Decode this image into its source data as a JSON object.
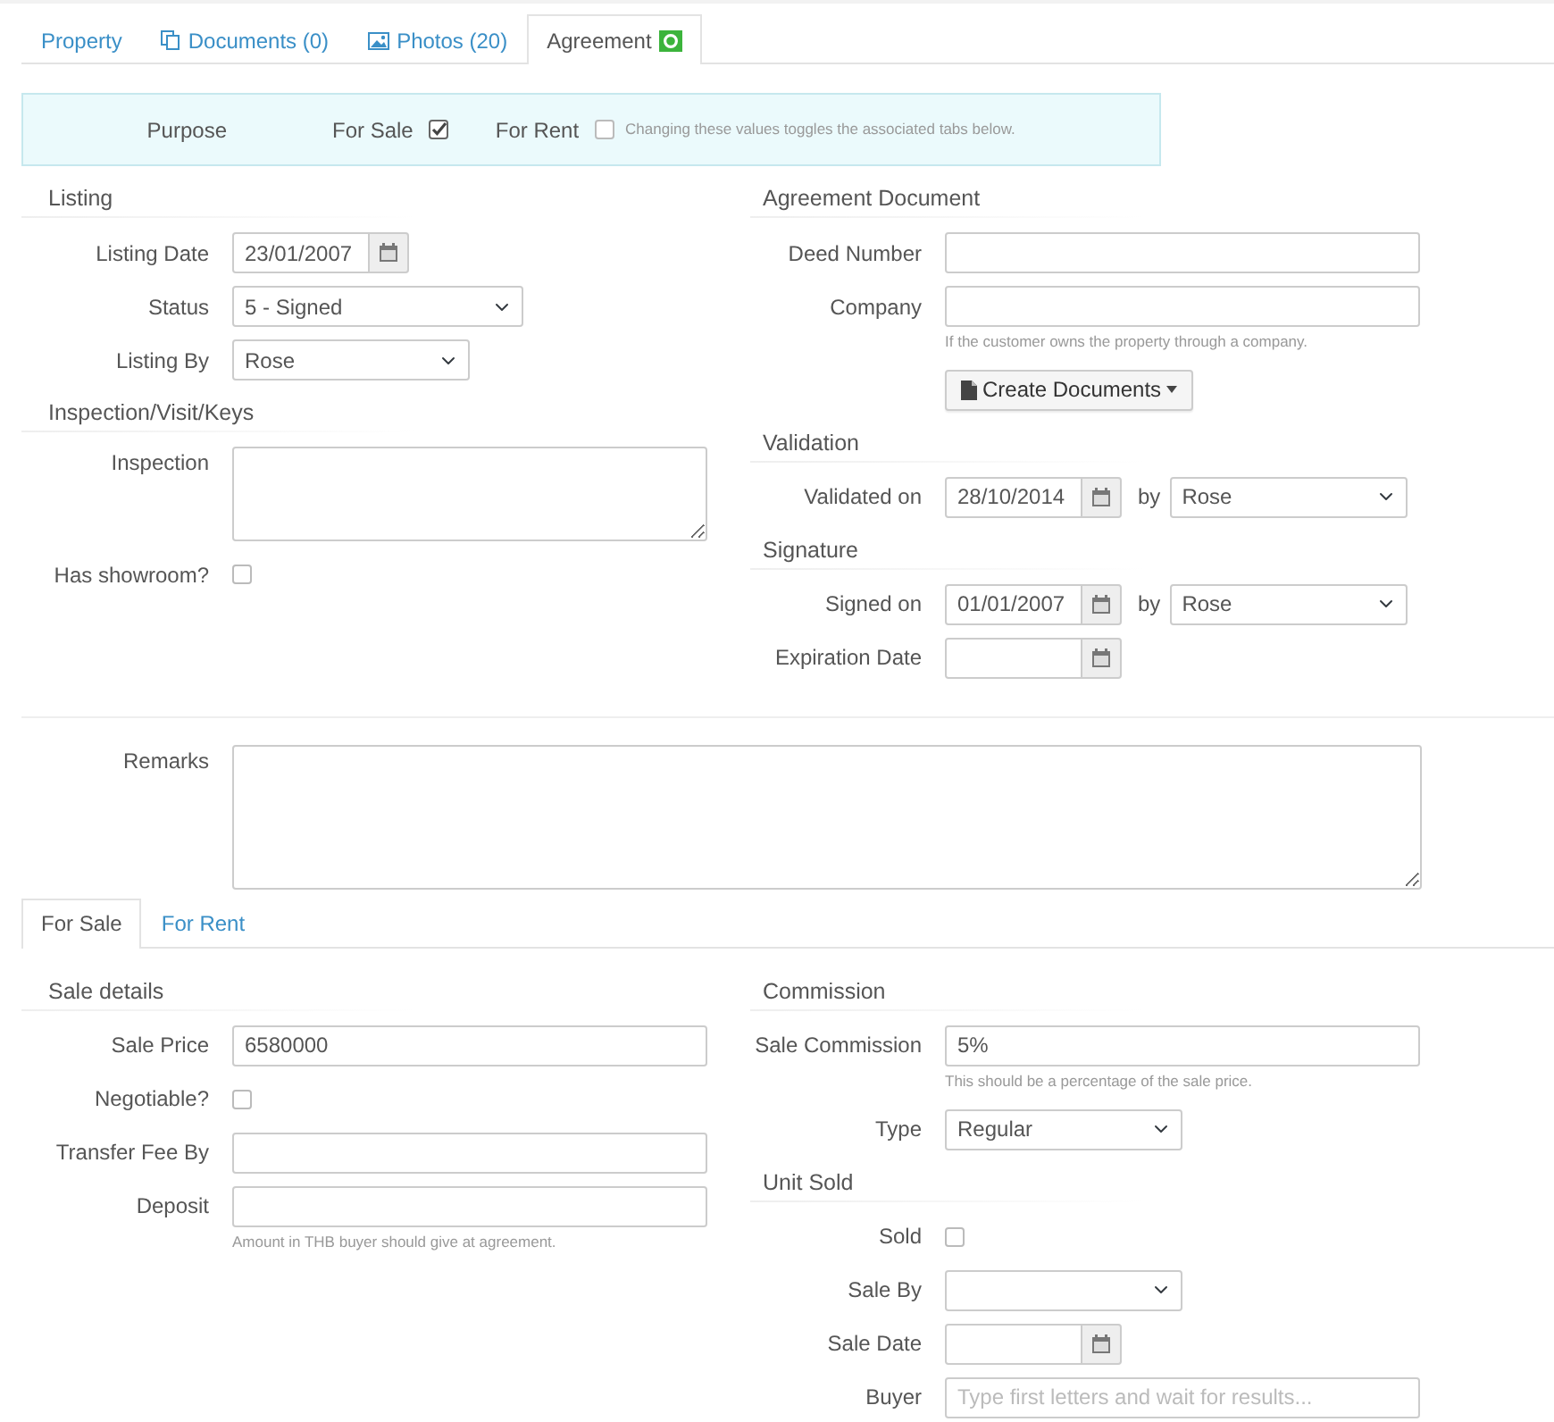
{
  "tabs": [
    {
      "label": "Property",
      "kind": "plain",
      "selected": false
    },
    {
      "label": "Documents (0)",
      "kind": "copy",
      "selected": false
    },
    {
      "label": "Photos (20)",
      "kind": "image",
      "selected": false
    },
    {
      "label": "Agreement",
      "kind": "badge",
      "selected": true
    }
  ],
  "purpose": {
    "label": "Purpose",
    "options": [
      {
        "label": "For Sale",
        "checked": true
      },
      {
        "label": "For Rent",
        "checked": false
      }
    ],
    "note": "Changing these values toggles the associated tabs below."
  },
  "agreement": {
    "left": [
      {
        "kind": "heading",
        "text": "Listing"
      },
      {
        "kind": "date",
        "label": "Listing Date",
        "value": "23/01/2007"
      },
      {
        "kind": "select",
        "label": "Status",
        "value": "5 - Signed"
      },
      {
        "kind": "select",
        "label": "Listing By",
        "value": "Rose"
      },
      {
        "kind": "heading",
        "text": "Inspection/Visit/Keys"
      },
      {
        "kind": "textarea",
        "label": "Inspection"
      },
      {
        "kind": "checkbox",
        "label": "Has showroom?",
        "checked": false
      }
    ],
    "right": [
      {
        "kind": "heading",
        "text": "Agreement Document"
      },
      {
        "kind": "text",
        "label": "Deed Number"
      },
      {
        "kind": "text",
        "label": "Company"
      },
      {
        "kind": "help",
        "text": "If the customer owns the property through a company."
      },
      {
        "kind": "button",
        "text": "Create Documents"
      },
      {
        "kind": "heading",
        "text": "Validation"
      },
      {
        "kind": "date-by",
        "label": "Validated on",
        "value": "28/10/2014",
        "by": "by",
        "by_value": "Rose"
      },
      {
        "kind": "heading",
        "text": "Signature"
      },
      {
        "kind": "date-by",
        "label": "Signed on",
        "value": "01/01/2007",
        "by": "by",
        "by_value": "Rose"
      },
      {
        "kind": "date",
        "label": "Expiration Date"
      }
    ]
  },
  "remarks": {
    "label": "Remarks"
  },
  "sub_tabs": [
    {
      "label": "For Sale",
      "selected": true
    },
    {
      "label": "For Rent",
      "selected": false
    }
  ],
  "sale": {
    "left": [
      {
        "kind": "heading",
        "text": "Sale details"
      },
      {
        "kind": "text",
        "label": "Sale Price",
        "value": "6580000"
      },
      {
        "kind": "checkbox",
        "label": "Negotiable?",
        "checked": false
      },
      {
        "kind": "text",
        "label": "Transfer Fee By"
      },
      {
        "kind": "text",
        "label": "Deposit"
      },
      {
        "kind": "help",
        "text": "Amount in THB buyer should give at agreement."
      }
    ],
    "right": [
      {
        "kind": "heading",
        "text": "Commission"
      },
      {
        "kind": "text",
        "label": "Sale Commission",
        "value": "5%"
      },
      {
        "kind": "help",
        "text": "This should be a percentage of the sale price."
      },
      {
        "kind": "select",
        "label": "Type",
        "value": "Regular"
      },
      {
        "kind": "heading",
        "text": "Unit Sold"
      },
      {
        "kind": "checkbox",
        "label": "Sold",
        "checked": false
      },
      {
        "kind": "select",
        "label": "Sale By"
      },
      {
        "kind": "date",
        "label": "Sale Date"
      },
      {
        "kind": "text",
        "label": "Buyer",
        "placeholder": "Type first letters and wait for results..."
      }
    ]
  }
}
